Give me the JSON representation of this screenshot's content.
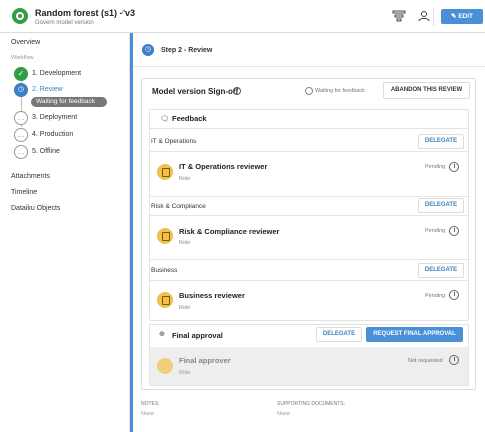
{
  "header": {
    "title": "Random forest (s1) - v3",
    "subtitle": "Govern model version",
    "edit_label": "EDIT"
  },
  "sidebar": {
    "overview": "Overview",
    "workflow_label": "Workflow",
    "steps": [
      {
        "label": "1. Development",
        "state": "done"
      },
      {
        "label": "2. Review",
        "state": "current"
      },
      {
        "label": "3. Deployment",
        "state": "todo"
      },
      {
        "label": "4. Production",
        "state": "todo"
      },
      {
        "label": "5. Offline",
        "state": "todo"
      }
    ],
    "waiting_badge": "Waiting for feedback",
    "links": [
      "Attachments",
      "Timeline",
      "Dataiku Objects"
    ]
  },
  "main": {
    "step_title": "Step 2 - Review",
    "card_title": "Model version Sign-off",
    "status": "Waiting for feedback",
    "abandon_label": "ABANDON THIS REVIEW",
    "feedback": {
      "title": "Feedback",
      "groups": [
        {
          "name": "IT & Operations",
          "delegate": "DELEGATE",
          "reviewer": "IT & Operations reviewer",
          "role": "Role",
          "status": "Pending"
        },
        {
          "name": "Risk & Compliance",
          "delegate": "DELEGATE",
          "reviewer": "Risk & Compliance reviewer",
          "role": "Role",
          "status": "Pending"
        },
        {
          "name": "Business",
          "delegate": "DELEGATE",
          "reviewer": "Business reviewer",
          "role": "Role",
          "status": "Pending"
        }
      ]
    },
    "final_approval": {
      "title": "Final approval",
      "delegate": "DELEGATE",
      "request_label": "REQUEST FINAL APPROVAL",
      "approver": "Final approver",
      "role": "Role",
      "status": "Not requested"
    },
    "notes_label": "NOTES:",
    "notes_value": "None",
    "docs_label": "SUPPORTING DOCUMENTS:",
    "docs_value": "None"
  },
  "colors": {
    "accent": "#4a90d9",
    "success": "#2f9e44",
    "reviewer_icon": "#f0c14b"
  }
}
